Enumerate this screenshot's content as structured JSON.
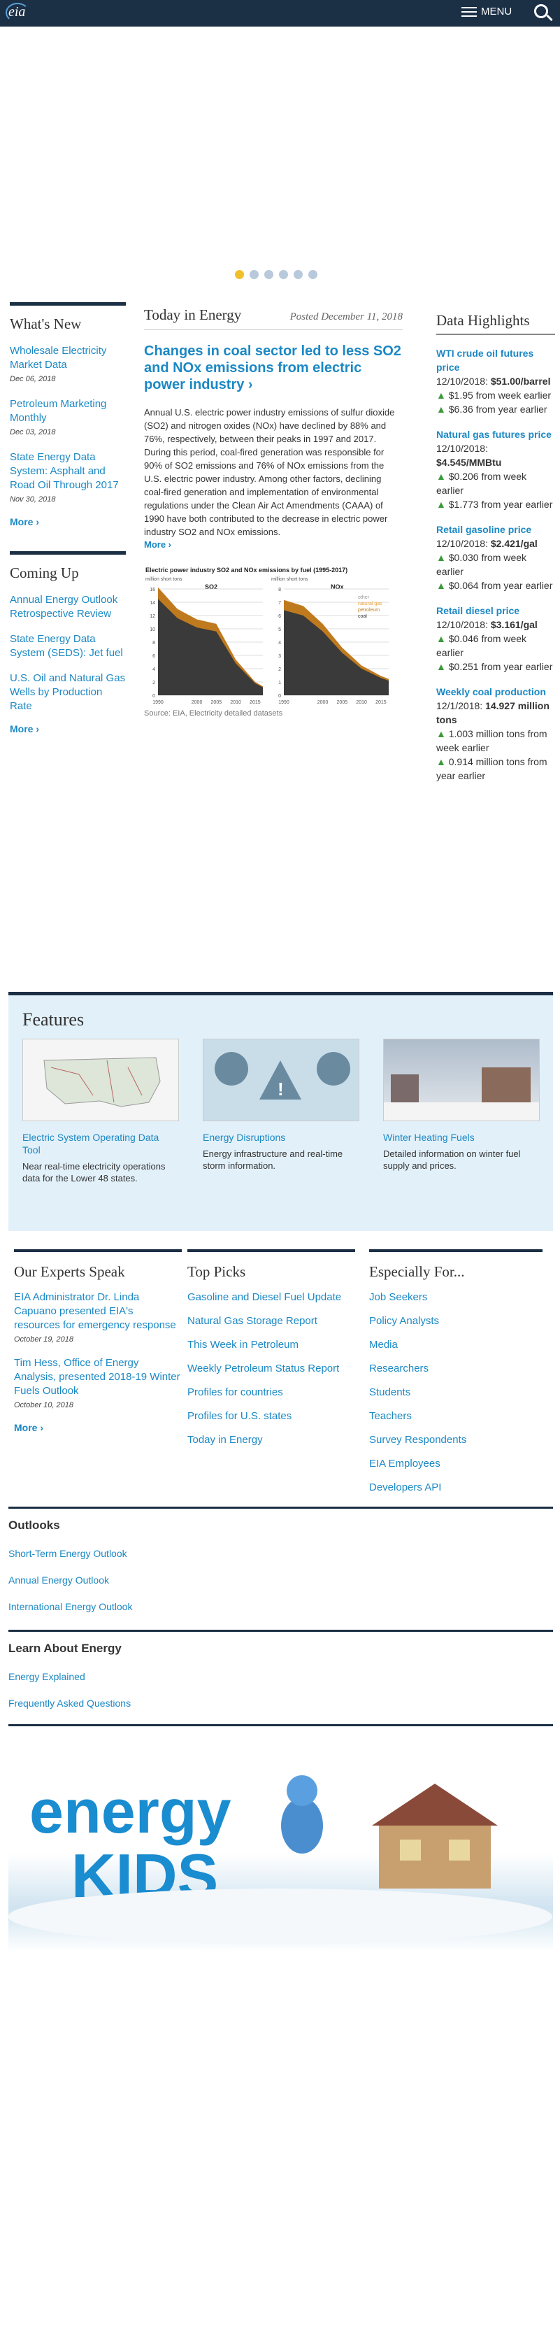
{
  "header": {
    "logo": "eia",
    "menu_label": "MENU"
  },
  "carousel": {
    "dots": 6,
    "active": 0
  },
  "whats_new": {
    "heading": "What's New",
    "items": [
      {
        "title": "Wholesale Electricity Market Data",
        "date": "Dec 06, 2018"
      },
      {
        "title": "Petroleum Marketing Monthly",
        "date": "Dec 03, 2018"
      },
      {
        "title": "State Energy Data System: Asphalt and Road Oil Through 2017",
        "date": "Nov 30, 2018"
      }
    ],
    "more": "More ›"
  },
  "coming_up": {
    "heading": "Coming Up",
    "items": [
      "Annual Energy Outlook Retrospective Review",
      "State Energy Data System (SEDS): Jet fuel",
      "U.S. Oil and Natural Gas Wells by Production Rate"
    ],
    "more": "More ›"
  },
  "today": {
    "heading": "Today in Energy",
    "date": "Posted December 11, 2018",
    "headline": "Changes in coal sector led to less SO2 and NOx emissions from electric power industry ›",
    "body": "Annual U.S. electric power industry emissions of sulfur dioxide (SO2) and nitrogen oxides (NOx) have declined by 88% and 76%, respectively, between their peaks in 1997 and 2017. During this period, coal-fired generation was responsible for 90% of SO2 emissions and 76% of NOx emissions from the U.S. electric power industry. Among other factors, declining coal-fired generation and implementation of environmental regulations under the Clean Air Act Amendments (CAAA) of 1990 have both contributed to the decrease in electric power industry SO2 and NOx emissions.",
    "more": "More ›",
    "source": "Source: EIA, Electricity detailed datasets"
  },
  "chart_data": {
    "type": "area",
    "title": "Electric power industry SO2 and NOx emissions by fuel (1995-2017)",
    "panels": [
      {
        "name": "SO2",
        "ylabel": "million short tons",
        "ylim": [
          0,
          16
        ],
        "yticks": [
          0,
          2,
          4,
          6,
          8,
          10,
          12,
          14,
          16
        ],
        "x": [
          1990,
          1995,
          2000,
          2005,
          2010,
          2015,
          2017
        ],
        "series": [
          {
            "name": "coal",
            "values": [
              14.5,
              11.6,
              10.2,
              9.6,
              4.8,
              1.8,
              1.2
            ]
          }
        ]
      },
      {
        "name": "NOx",
        "ylabel": "million short tons",
        "ylim": [
          0,
          8
        ],
        "yticks": [
          0,
          1,
          2,
          3,
          4,
          5,
          6,
          7,
          8
        ],
        "x": [
          1990,
          1995,
          2000,
          2005,
          2010,
          2015,
          2017
        ],
        "series": [
          {
            "name": "coal",
            "values": [
              6.4,
              6.0,
              4.8,
              3.2,
              2.0,
              1.3,
              1.1
            ]
          }
        ]
      }
    ],
    "legend": [
      "other",
      "natural gas",
      "petroleum",
      "coal"
    ],
    "xticks": [
      "1990",
      "2000",
      "2005",
      "2010",
      "2015"
    ],
    "colors": {
      "coal": "#3a3a3a",
      "petroleum": "#c07a1e",
      "natural_gas": "#e8a33a",
      "other": "#9a9a9a"
    }
  },
  "data_highlights": {
    "heading": "Data Highlights",
    "items": [
      {
        "title": "WTI crude oil futures price",
        "date": "12/10/2018:",
        "value": "$51.00/barrel",
        "c1": "$1.95 from week earlier",
        "c2": "$6.36 from year earlier"
      },
      {
        "title": "Natural gas futures price",
        "date": "12/10/2018:",
        "value": "$4.545/MMBtu",
        "c1": "$0.206 from week earlier",
        "c2": "$1.773 from year earlier"
      },
      {
        "title": "Retail gasoline price",
        "date": "12/10/2018:",
        "value": "$2.421/gal",
        "c1": "$0.030 from week earlier",
        "c2": "$0.064 from year earlier"
      },
      {
        "title": "Retail diesel price",
        "date": "12/10/2018:",
        "value": "$3.161/gal",
        "c1": "$0.046 from week earlier",
        "c2": "$0.251 from year earlier"
      },
      {
        "title": "Weekly coal production",
        "date": "12/1/2018:",
        "value": "14.927 million tons",
        "c1": "1.003 million tons from week earlier",
        "c2": "0.914 million tons from year earlier"
      }
    ]
  },
  "features": {
    "heading": "Features",
    "cards": [
      {
        "title": "Electric System Operating Data Tool",
        "desc": "Near real-time electricity operations data for the Lower 48 states."
      },
      {
        "title": "Energy Disruptions",
        "desc": "Energy infrastructure and real-time storm information."
      },
      {
        "title": "Winter Heating Fuels",
        "desc": "Detailed information on winter fuel supply and prices."
      }
    ]
  },
  "experts": {
    "heading": "Our Experts Speak",
    "items": [
      {
        "title": "EIA Administrator Dr. Linda Capuano presented EIA's resources for emergency response",
        "date": "October 19, 2018"
      },
      {
        "title": "Tim Hess, Office of Energy Analysis, presented 2018-19 Winter Fuels Outlook",
        "date": "October 10, 2018"
      }
    ],
    "more": "More ›"
  },
  "top_picks": {
    "heading": "Top Picks",
    "items": [
      "Gasoline and Diesel Fuel Update",
      "Natural Gas Storage Report",
      "This Week in Petroleum",
      "Weekly Petroleum Status Report",
      "Profiles for countries",
      "Profiles for U.S. states",
      "Today in Energy"
    ]
  },
  "especially": {
    "heading": "Especially For...",
    "items": [
      "Job Seekers",
      "Policy Analysts",
      "Media",
      "Researchers",
      "Students",
      "Teachers",
      "Survey Respondents",
      "EIA Employees",
      "Developers API"
    ]
  },
  "outlooks": {
    "heading": "Outlooks",
    "items": [
      "Short-Term Energy Outlook",
      "Annual Energy Outlook",
      "International Energy Outlook"
    ]
  },
  "learn": {
    "heading": "Learn About Energy",
    "items": [
      "Energy Explained",
      "Frequently Asked Questions"
    ]
  },
  "kids": {
    "text": "energy KIDS"
  }
}
